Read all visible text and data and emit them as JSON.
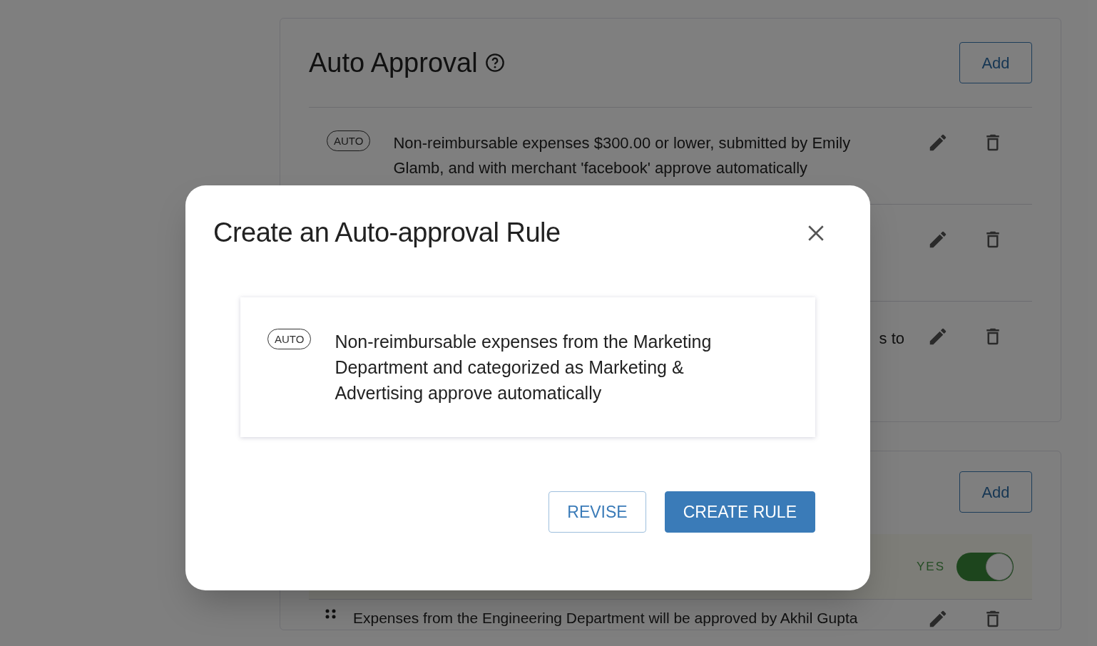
{
  "auto_approval": {
    "title": "Auto Approval",
    "add_button": "Add",
    "rules": [
      {
        "kind": "rule",
        "badge": "AUTO",
        "text": "Non-reimbursable expenses $300.00 or lower, submitted by Emily Glamb, and with merchant 'facebook' approve automatically"
      },
      {
        "kind": "rule"
      },
      {
        "kind": "rule",
        "text": "s to"
      }
    ]
  },
  "approval_workflows": {
    "add_button": "Add",
    "toggle": {
      "label": "YES",
      "on": true
    },
    "rules": [
      {
        "text": "Expenses from the Engineering Department will be approved by Akhil Gupta"
      }
    ]
  },
  "dialog": {
    "title": "Create an Auto-approval Rule",
    "rule": {
      "badge": "AUTO",
      "text": "Non-reimbursable expenses from the Marketing Department and categorized as Marketing & Advertising approve automatically"
    },
    "buttons": [
      {
        "label": "REVISE",
        "kind": "secondary"
      },
      {
        "label": "CREATE RULE",
        "kind": "primary"
      }
    ]
  }
}
